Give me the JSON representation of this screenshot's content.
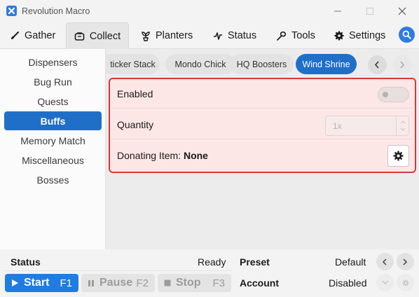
{
  "app": {
    "title": "Revolution Macro"
  },
  "tabs": [
    {
      "label": "Gather",
      "icon": "shovel-icon"
    },
    {
      "label": "Collect",
      "icon": "bag-icon",
      "active": true
    },
    {
      "label": "Planters",
      "icon": "planter-icon"
    },
    {
      "label": "Status",
      "icon": "pulse-icon"
    },
    {
      "label": "Tools",
      "icon": "wrench-icon"
    },
    {
      "label": "Settings",
      "icon": "gear-icon"
    }
  ],
  "sidebar": {
    "items": [
      {
        "label": "Dispensers"
      },
      {
        "label": "Bug Run"
      },
      {
        "label": "Quests"
      },
      {
        "label": "Buffs",
        "active": true
      },
      {
        "label": "Memory Match"
      },
      {
        "label": "Miscellaneous"
      },
      {
        "label": "Bosses"
      }
    ]
  },
  "subtabs": [
    {
      "label": "ticker Stack"
    },
    {
      "label": "Mondo Chick"
    },
    {
      "label": "HQ Boosters"
    },
    {
      "label": "Wind Shrine",
      "active": true
    }
  ],
  "settings": {
    "enabled_label": "Enabled",
    "enabled": false,
    "quantity_label": "Quantity",
    "quantity_value": "1x",
    "donating_label": "Donating Item:",
    "donating_value": "None"
  },
  "bottom": {
    "status_label": "Status",
    "status_value": "Ready",
    "preset_label": "Preset",
    "preset_value": "Default",
    "account_label": "Account",
    "account_value": "Disabled",
    "start_label": "Start",
    "start_key": "F1",
    "pause_label": "Pause",
    "pause_key": "F2",
    "stop_label": "Stop",
    "stop_key": "F3"
  },
  "colors": {
    "accent": "#1f6fc9",
    "highlight_border": "#d9383a",
    "highlight_bg": "#fde6e6"
  }
}
